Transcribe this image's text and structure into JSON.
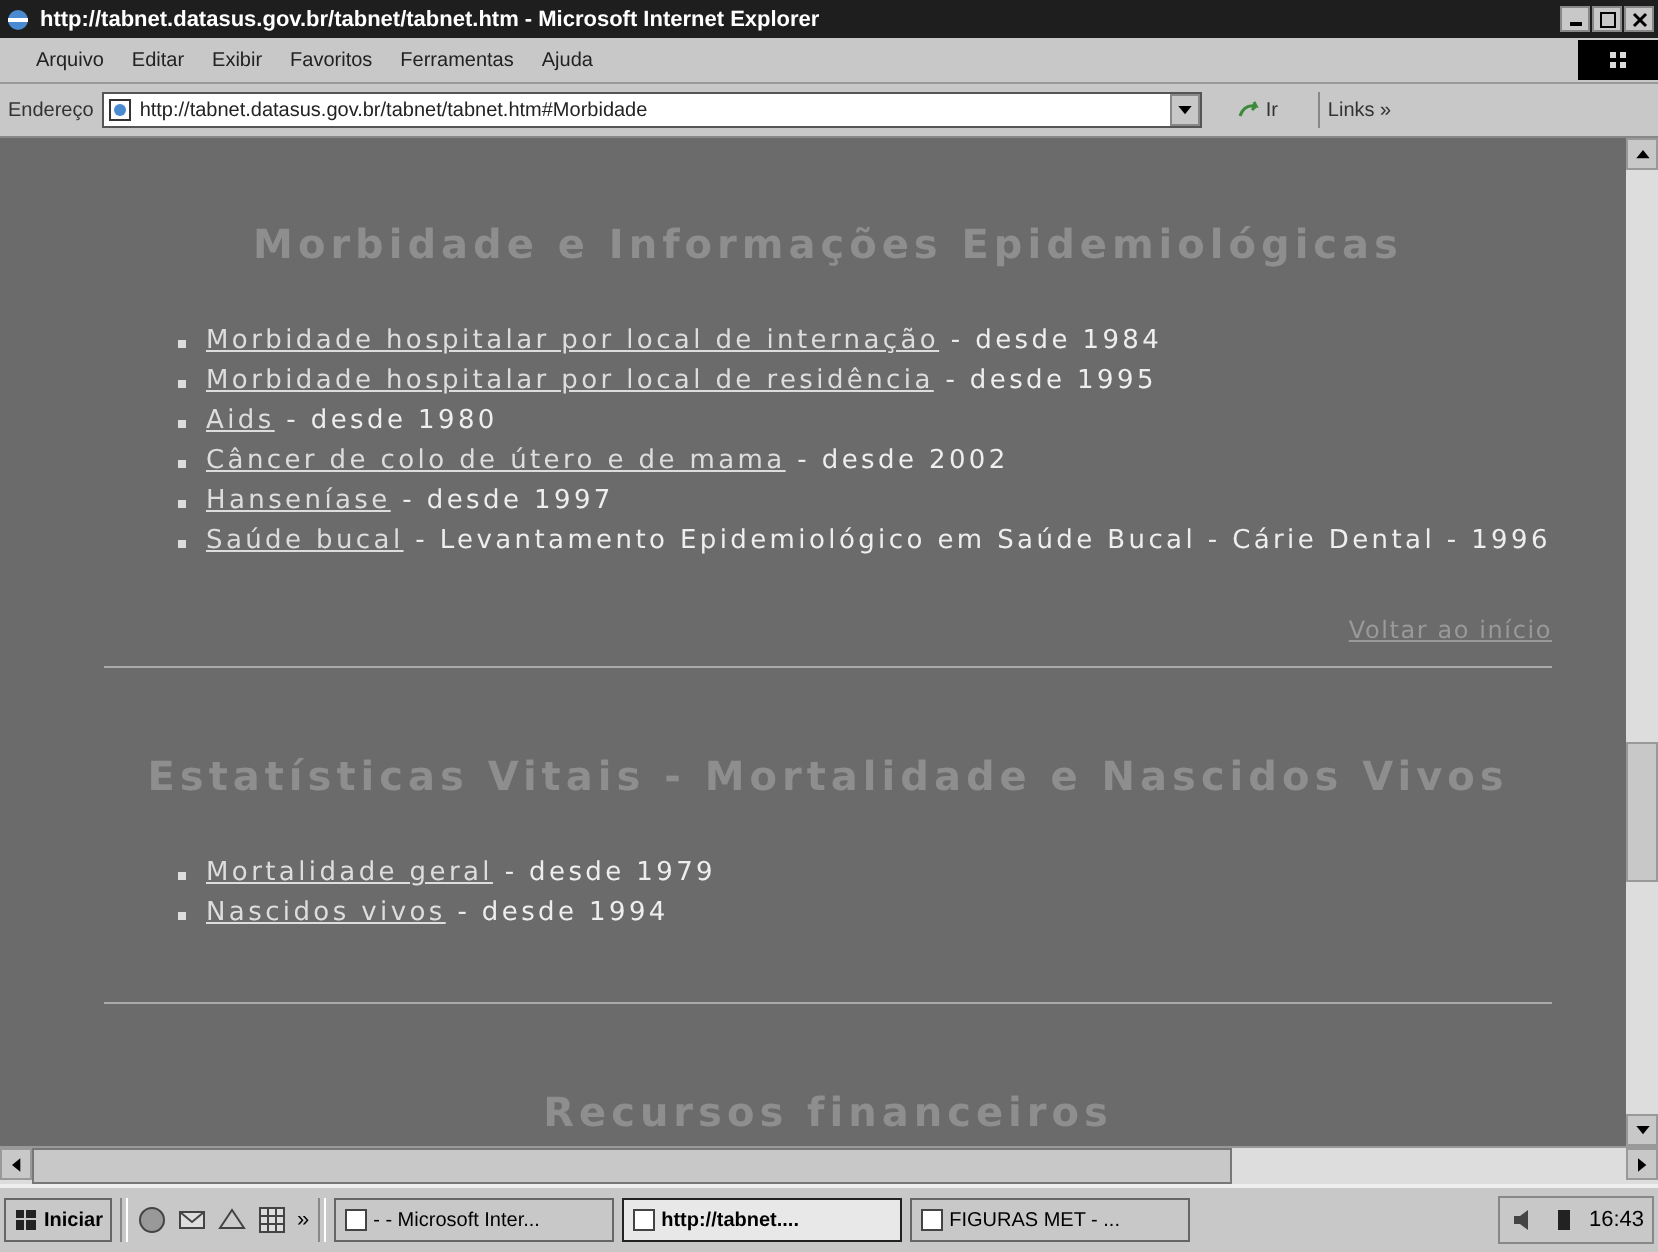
{
  "window": {
    "title": "http://tabnet.datasus.gov.br/tabnet/tabnet.htm - Microsoft Internet Explorer"
  },
  "menu": [
    "Arquivo",
    "Editar",
    "Exibir",
    "Favoritos",
    "Ferramentas",
    "Ajuda"
  ],
  "address_bar": {
    "label": "Endereço",
    "value": "http://tabnet.datasus.gov.br/tabnet/tabnet.htm#Morbidade",
    "go": "Ir",
    "links": "Links »"
  },
  "sections": [
    {
      "heading": "Morbidade e Informações Epidemiológicas",
      "items": [
        {
          "link": "Morbidade hospitalar por local de internação",
          "text": " - desde 1984"
        },
        {
          "link": "Morbidade hospitalar por local de residência",
          "text": " - desde 1995"
        },
        {
          "link": "Aids",
          "text": " - desde 1980"
        },
        {
          "link": "Câncer de colo de útero e de mama",
          "text": " - desde 2002"
        },
        {
          "link": "Hanseníase",
          "text": " - desde 1997"
        },
        {
          "link": "Saúde bucal",
          "text": " - Levantamento Epidemiológico em Saúde Bucal - Cárie Dental - 1996"
        }
      ],
      "back_link": "Voltar ao início"
    },
    {
      "heading": "Estatísticas Vitais - Mortalidade e Nascidos Vivos",
      "items": [
        {
          "link": "Mortalidade geral",
          "text": " - desde 1979"
        },
        {
          "link": "Nascidos vivos",
          "text": " - desde 1994"
        }
      ]
    },
    {
      "heading": "Recursos financeiros"
    }
  ],
  "taskbar": {
    "start": "Iniciar",
    "more": "»",
    "tasks": [
      {
        "label": "- - Microsoft Inter...",
        "selected": false
      },
      {
        "label": "http://tabnet....",
        "selected": true
      },
      {
        "label": "FIGURAS MET - ...",
        "selected": false
      }
    ],
    "clock": "16:43"
  }
}
